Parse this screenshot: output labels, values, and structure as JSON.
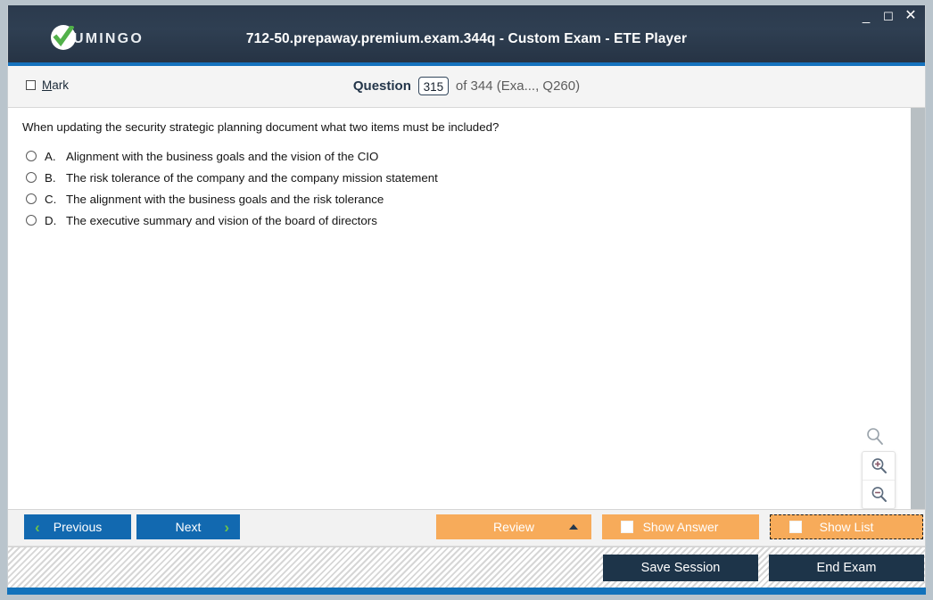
{
  "window": {
    "title": "712-50.prepaway.premium.exam.344q - Custom Exam - ETE Player",
    "logo_text": "UMINGO",
    "controls": {
      "minimize": "_",
      "maximize": "☐",
      "close": "✕"
    },
    "colors": {
      "titlebar": "#2b3a4d",
      "accent_blue": "#1572bd",
      "primary_button": "#1269b0",
      "orange_button": "#f7ab5a",
      "dark_button": "#1d3449",
      "chevron_green": "#6cc24a"
    }
  },
  "question_header": {
    "mark_label_prefix": "M",
    "mark_label_rest": "ark",
    "mark_checked": false,
    "question_label": "Question",
    "question_number": "315",
    "of_text": "of 344 (Exa..., Q260)"
  },
  "question": {
    "text": "When updating the security strategic planning document what two items must be included?",
    "options": [
      {
        "letter": "A.",
        "text": "Alignment with the business goals and the vision of the CIO",
        "selected": false
      },
      {
        "letter": "B.",
        "text": "The risk tolerance of the company and the company mission statement",
        "selected": false
      },
      {
        "letter": "C.",
        "text": "The alignment with the business goals and the risk tolerance",
        "selected": false
      },
      {
        "letter": "D.",
        "text": "The executive summary and vision of the board of directors",
        "selected": false
      }
    ]
  },
  "zoom_controls": {
    "hint_icon": "magnifier-icon",
    "zoom_in_icon": "zoom-in-icon",
    "zoom_out_icon": "zoom-out-icon"
  },
  "toolbar": {
    "previous_label": "Previous",
    "next_label": "Next",
    "review_label": "Review",
    "show_answer_label": "Show Answer",
    "show_list_label": "Show List",
    "prev_chevron": "‹",
    "next_chevron": "›"
  },
  "footer": {
    "save_session_label": "Save Session",
    "end_exam_label": "End Exam"
  }
}
